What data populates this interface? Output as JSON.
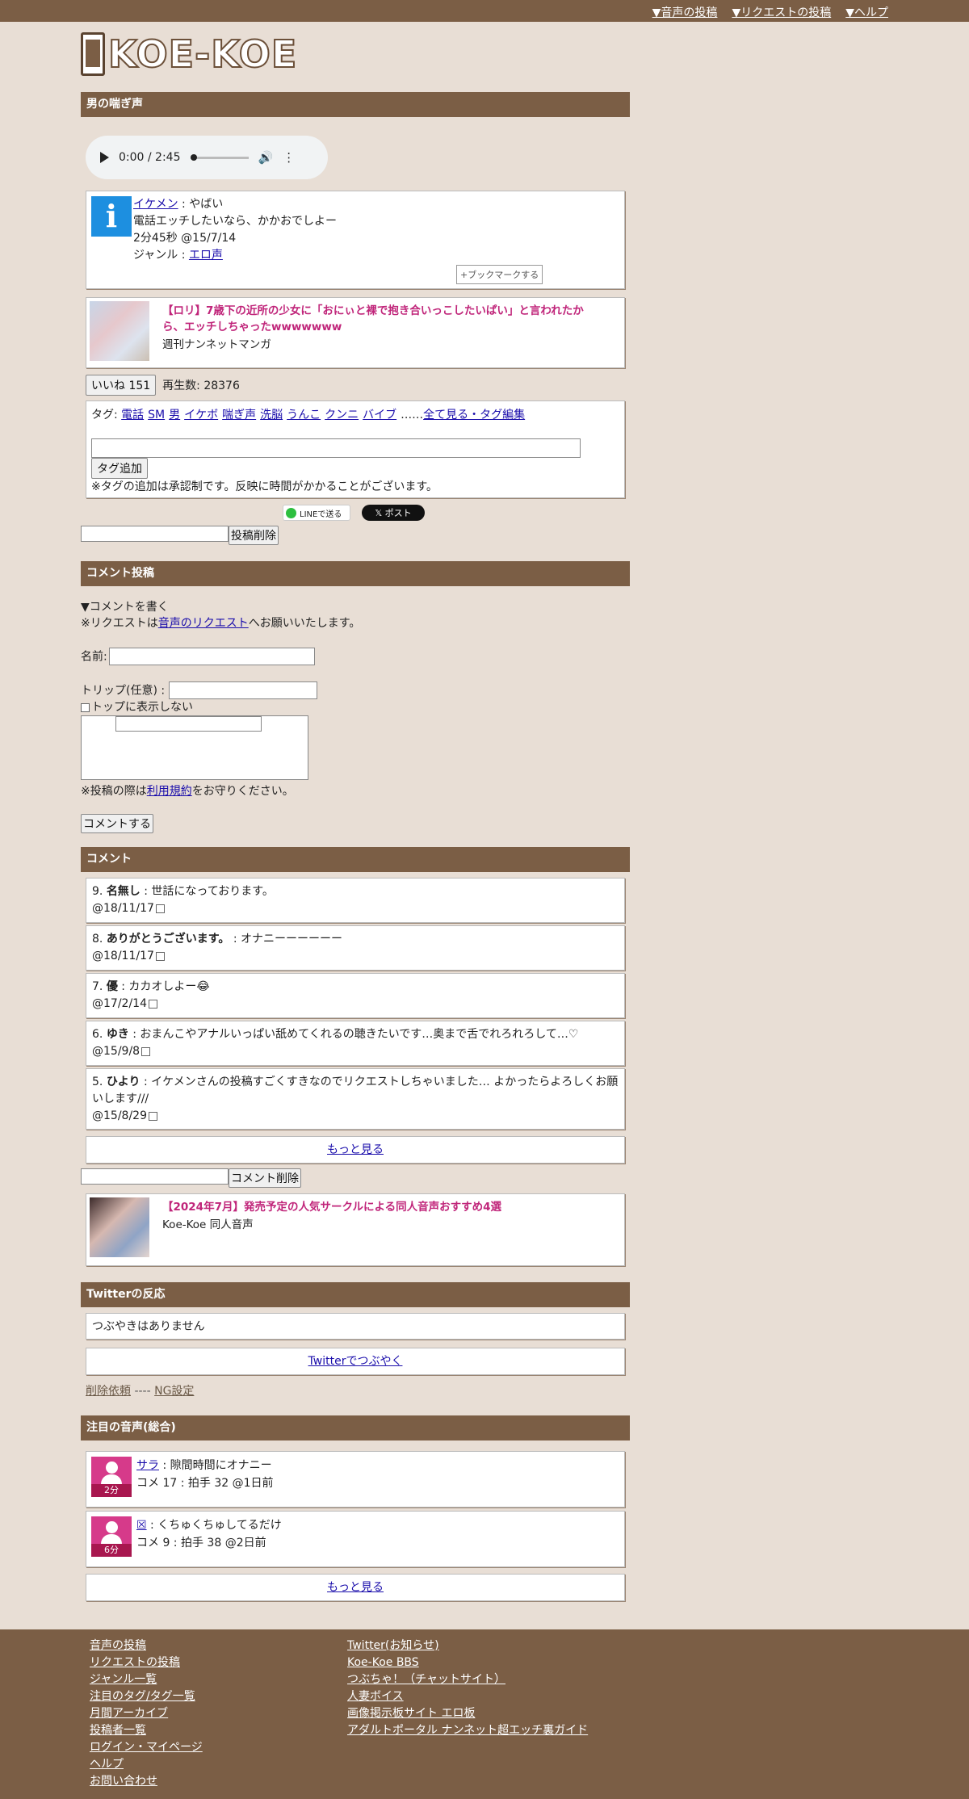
{
  "topnav": {
    "items": [
      "▼音声の投稿",
      "▼リクエストの投稿",
      "▼ヘルプ"
    ]
  },
  "logo": {
    "text": "KOE-KOE"
  },
  "voice": {
    "heading": "男の喘ぎ声",
    "player": {
      "time": "0:00 / 2:45"
    },
    "poster_name": "イケメン",
    "title_suffix": " : やばい",
    "description": "電話エッチしたいなら、かかおでしよー",
    "meta": "2分45秒 @15/7/14",
    "genre_label": "ジャンル : ",
    "genre": "エロ声",
    "bookmark_label": "+ブックマークする"
  },
  "ad1": {
    "title": "【ロリ】7歳下の近所の少女に「おにぃと裸で抱き合いっこしたいぱい」と言われたから、エッチしちゃったwwwwwww",
    "source": "週刊ナンネットマンガ"
  },
  "like": {
    "button": "いいね 151",
    "plays": "再生数: 28376"
  },
  "tags": {
    "label": "タグ: ",
    "items": [
      "電話",
      "SM",
      "男",
      "イケボ",
      "喘ぎ声",
      "洗脳",
      "うんこ",
      "クンニ",
      "バイブ"
    ],
    "ellipsis": "……",
    "all_link": "全て見る・タグ編集",
    "add_button": "タグ追加",
    "note": "※タグの追加は承認制です。反映に時間がかかることがございます。"
  },
  "share": {
    "line": "LINEで送る",
    "x": "𝕏 ポスト"
  },
  "post_delete": {
    "button": "投稿削除"
  },
  "comment_form": {
    "heading": "コメント投稿",
    "write_toggle": "▼コメントを書く",
    "request_prefix": "※リクエストは",
    "request_link": "音声のリクエスト",
    "request_suffix": "へお願いいたします。",
    "name_label": "名前:",
    "trip_label": "トリップ(任意) :",
    "hide_top_label": "トップに表示しない",
    "terms_prefix": "※投稿の際は",
    "terms_link": "利用規約",
    "terms_suffix": "をお守りください。",
    "submit": "コメントする"
  },
  "comments": {
    "heading": "コメント",
    "items": [
      {
        "no": "9.",
        "name": "名無し",
        "body": " : 世話になっております。",
        "date": "@18/11/17"
      },
      {
        "no": "8.",
        "name": "ありがとうございます。",
        "body": " : オナニーーーーーー",
        "date": "@18/11/17"
      },
      {
        "no": "7.",
        "name": "優",
        "body": " : カカオしよー😂",
        "date": "@17/2/14"
      },
      {
        "no": "6.",
        "name": "ゆき",
        "body": " : おまんこやアナルいっぱい舐めてくれるの聴きたいです…奥まで舌でれろれろして…♡",
        "date": "@15/9/8"
      },
      {
        "no": "5.",
        "name": "ひより",
        "body": " : イケメンさんの投稿すごくすきなのでリクエストしちゃいました… よかったらよろしくお願いします///",
        "date": "@15/8/29"
      }
    ],
    "more": "もっと見る",
    "delete_button": "コメント削除"
  },
  "ad2": {
    "title": "【2024年7月】発売予定の人気サークルによる同人音声おすすめ4選",
    "source": "Koe-Koe 同人音声"
  },
  "twitter": {
    "heading": "Twitterの反応",
    "empty": "つぶやきはありません",
    "tweet_link": "Twitterでつぶやく",
    "delete_request": "削除依頼",
    "separator": " ---- ",
    "ng": "NG設定"
  },
  "notable": {
    "heading": "注目の音声(総合)",
    "items": [
      {
        "duration": "2分",
        "user": "サラ",
        "title": " : 隙間時間にオナニー",
        "stats": "コメ 17 : 拍手 32 @1日前"
      },
      {
        "duration": "6分",
        "user": "☒",
        "title": " : くちゅくちゅしてるだけ",
        "stats": "コメ 9 : 拍手 38 @2日前"
      }
    ],
    "more": "もっと見る"
  },
  "footer": {
    "col1": [
      "音声の投稿",
      "リクエストの投稿",
      "ジャンル一覧",
      "注目のタグ/タグ一覧",
      "月間アーカイブ",
      "投稿者一覧",
      "ログイン・マイページ",
      "ヘルプ",
      "お問い合わせ"
    ],
    "col2": [
      "Twitter(お知らせ)",
      "Koe-Koe BBS",
      "つぶちゃ！（チャットサイト）",
      "人妻ボイス",
      "画像掲示板サイト エロ板",
      "アダルトポータル ナンネット超エッチ裏ガイド"
    ]
  }
}
